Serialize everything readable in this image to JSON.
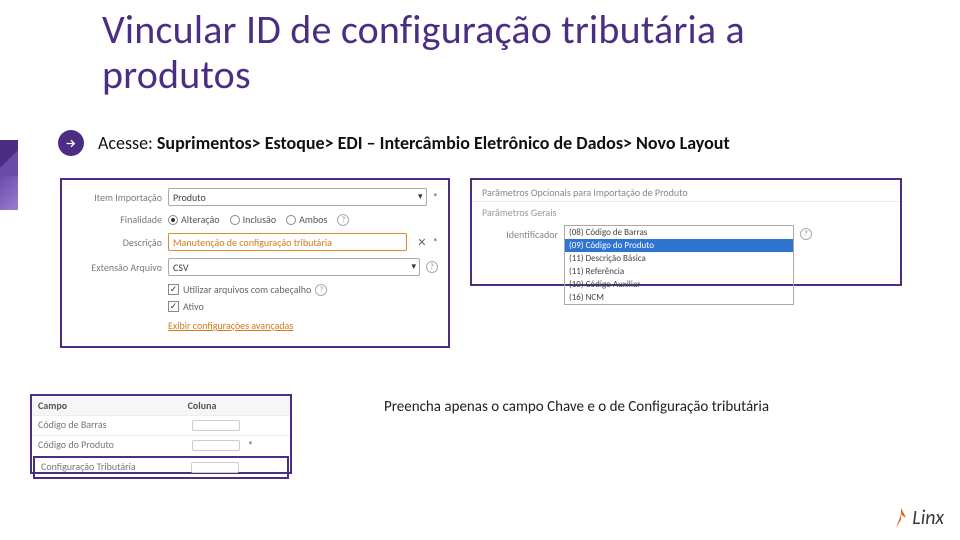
{
  "title": "Vincular ID de configuração tributária a produtos",
  "access": {
    "prefix": "Acesse:",
    "path": "Suprimentos> Estoque> EDI – Intercâmbio Eletrônico de Dados> Novo Layout"
  },
  "form_left": {
    "item_label": "Item Importação",
    "item_value": "Produto",
    "finalidade_label": "Finalidade",
    "finalidade": {
      "alteracao": "Alteração",
      "inclusao": "Inclusão",
      "ambos": "Ambos"
    },
    "descricao_label": "Descrição",
    "descricao_value": "Manutenção de configuração tributária",
    "ext_label": "Extensão Arquivo",
    "ext_value": "CSV",
    "chk_header": "Utilizar arquivos com cabeçalho",
    "chk_ativo": "Ativo",
    "link_adv": "Exibir configurações avançadas"
  },
  "panel_right": {
    "header1": "Parâmetros Opcionais para Importação de Produto",
    "header2": "Parâmetros Gerais",
    "ident_label": "Identificador",
    "options": [
      "(08) Código de Barras",
      "(09) Código do Produto",
      "(11) Descrição Básica",
      "(11) Referência",
      "(10) Código Auxiliar",
      "(16) NCM"
    ],
    "selected_index": 1
  },
  "table": {
    "col_campo": "Campo",
    "col_coluna": "Coluna",
    "rows": [
      "Código de Barras",
      "Código do Produto",
      "Configuração Tributária"
    ]
  },
  "note": "Preencha apenas o campo Chave e o de Configuração tributária",
  "logo_text": "Linx"
}
